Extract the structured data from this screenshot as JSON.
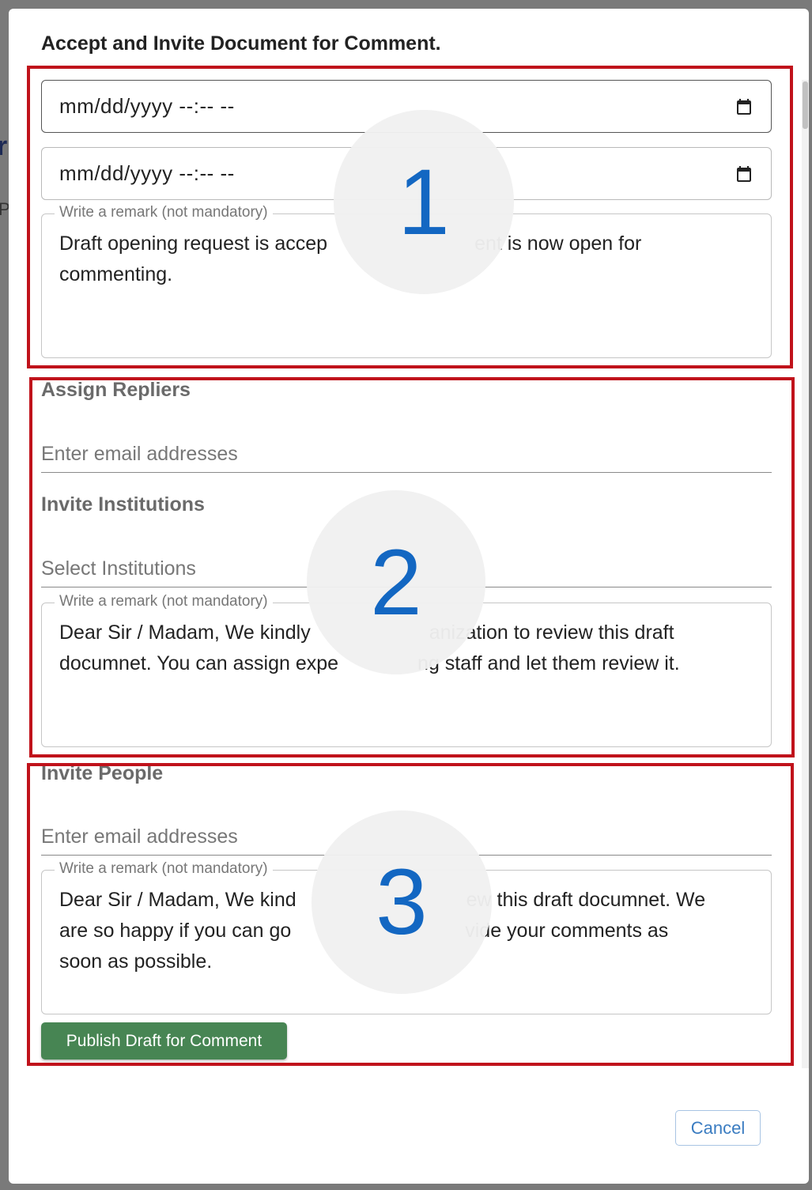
{
  "backdrop": {
    "peek_char": "r",
    "peek_small": "Pr"
  },
  "modal": {
    "title": "Accept and Invite Document for Comment."
  },
  "section1": {
    "start_datetime": "mm/dd/yyyy --:-- --",
    "end_datetime": "mm/dd/yyyy --:-- --",
    "remark_legend": "Write a remark (not mandatory)",
    "remark_value": "Draft opening request is accepted and the document is now open for commenting.",
    "remark_visible_part1": "Draft opening request is accep",
    "remark_visible_part2": "ent is now open for",
    "remark_visible_line2": "commenting."
  },
  "section2": {
    "assign_heading": "Assign Repliers",
    "assign_placeholder": "Enter email addresses",
    "invite_heading": "Invite Institutions",
    "invite_placeholder": "Select Institutions",
    "remark_legend": "Write a remark (not mandatory)",
    "remark_line1_a": "Dear Sir / Madam, We kindly",
    "remark_line1_b": "anization to review this draft",
    "remark_line2_a": "documnet. You can assign expe",
    "remark_line2_b": "ng staff and let them review it."
  },
  "section3": {
    "heading": "Invite People",
    "email_placeholder": "Enter email addresses",
    "remark_legend": "Write a remark (not mandatory)",
    "remark_line1_a": "Dear Sir / Madam, We kind",
    "remark_line1_b": "ew this draft documnet. We",
    "remark_line2_a": "are so happy if you can go",
    "remark_line2_b": "vide your comments as",
    "remark_line3": "soon as possible.",
    "publish_label": "Publish Draft for Comment"
  },
  "footer": {
    "cancel_label": "Cancel"
  },
  "annotations": [
    "1",
    "2",
    "3"
  ],
  "colors": {
    "highlight": "#c0121b",
    "number": "#1367c2",
    "publish": "#478553",
    "cancel_text": "#3a7cc1"
  },
  "icons": {
    "date_picker": "calendar-icon"
  }
}
